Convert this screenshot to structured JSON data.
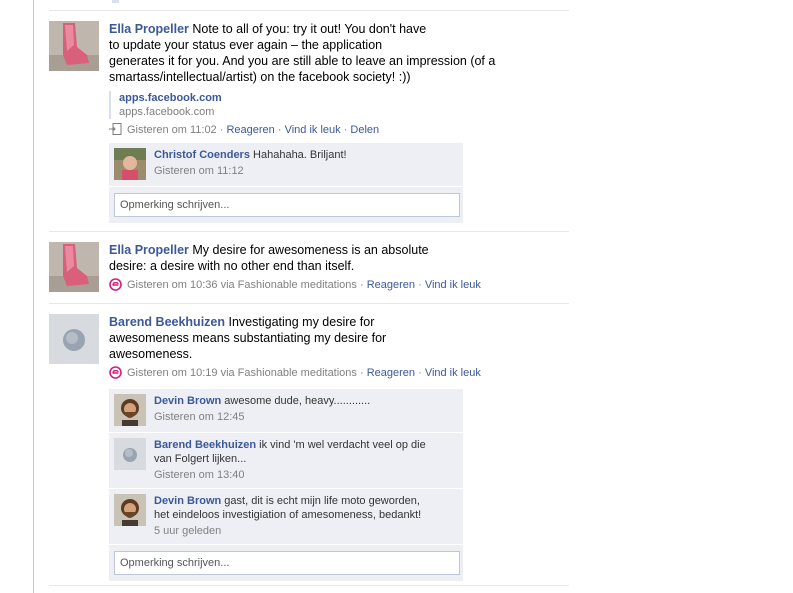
{
  "stories": [
    {
      "author": "Ella Propeller",
      "message_lines": [
        "Note to all of you: try it out! You don't have",
        "to update your status ever again – the application",
        "generates it for you. And you are still able to leave an impression (of a",
        "smartass/intellectual/artist) on the facebook society! :))"
      ],
      "attachment": {
        "title": "apps.facebook.com",
        "caption": "apps.facebook.com"
      },
      "timestamp": "Gisteren om 11:02",
      "actions": [
        "Reageren",
        "Vind ik leuk",
        "Delen"
      ],
      "separator": " · ",
      "comments": [
        {
          "author": "Christof Coenders",
          "text": "Hahahaha. Briljant!",
          "time": "Gisteren om 11:12"
        }
      ],
      "comment_placeholder": "Opmerking schrijven..."
    },
    {
      "author": "Ella Propeller",
      "message_lines": [
        "My desire for awesomeness is an absolute",
        "desire: a desire with no other end than itself."
      ],
      "timestamp": "Gisteren om 10:36",
      "via": "via Fashionable meditations",
      "actions": [
        "Reageren",
        "Vind ik leuk"
      ]
    },
    {
      "author": "Barend Beekhuizen",
      "message_lines": [
        "Investigating my desire for",
        "awesomeness means substantiating my desire for",
        "awesomeness."
      ],
      "timestamp": "Gisteren om 10:19",
      "via": "via Fashionable meditations",
      "actions": [
        "Reageren",
        "Vind ik leuk"
      ],
      "comments": [
        {
          "author": "Devin Brown",
          "text": "awesome dude, heavy............",
          "time": "Gisteren om 12:45"
        },
        {
          "author": "Barend Beekhuizen",
          "text_lines": [
            "ik vind 'm wel verdacht veel op die",
            "van Folgert lijken..."
          ],
          "time": "Gisteren om 13:40"
        },
        {
          "author": "Devin Brown",
          "text_lines": [
            "gast, dit is echt mijn life moto geworden,",
            "het eindeloos investigiation of amesomeness, bedankt!"
          ],
          "time": "5 uur geleden"
        }
      ],
      "comment_placeholder": "Opmerking schrijven..."
    }
  ],
  "colors": {
    "link": "#3b5998",
    "meta": "#808080",
    "comment_bg": "#edeff4",
    "app_icon": "#d61e7f"
  }
}
